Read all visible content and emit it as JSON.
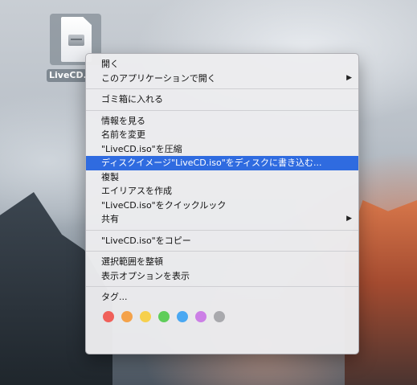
{
  "desktop": {
    "file_label": "LiveCD.iso"
  },
  "context_menu": {
    "group1": [
      {
        "label": "開く",
        "submenu": false
      },
      {
        "label": "このアプリケーションで開く",
        "submenu": true
      }
    ],
    "group2": [
      {
        "label": "ゴミ箱に入れる",
        "submenu": false
      }
    ],
    "group3": [
      {
        "label": "情報を見る",
        "submenu": false
      },
      {
        "label": "名前を変更",
        "submenu": false
      },
      {
        "label": "\"LiveCD.iso\"を圧縮",
        "submenu": false
      },
      {
        "label": "ディスクイメージ\"LiveCD.iso\"をディスクに書き込む...",
        "submenu": false,
        "highlighted": true
      },
      {
        "label": "複製",
        "submenu": false
      },
      {
        "label": "エイリアスを作成",
        "submenu": false
      },
      {
        "label": "\"LiveCD.iso\"をクイックルック",
        "submenu": false
      },
      {
        "label": "共有",
        "submenu": true
      }
    ],
    "group4": [
      {
        "label": "\"LiveCD.iso\"をコピー",
        "submenu": false
      }
    ],
    "group5": [
      {
        "label": "選択範囲を整頓",
        "submenu": false
      },
      {
        "label": "表示オプションを表示",
        "submenu": false
      }
    ],
    "group6": [
      {
        "label": "タグ...",
        "submenu": false
      }
    ],
    "submenu_arrow": "▶",
    "tag_colors": [
      {
        "name": "red",
        "color": "#f0605a"
      },
      {
        "name": "orange",
        "color": "#f4a24a"
      },
      {
        "name": "yellow",
        "color": "#f6d04d"
      },
      {
        "name": "green",
        "color": "#5fcd5a"
      },
      {
        "name": "blue",
        "color": "#4aa8f2"
      },
      {
        "name": "purple",
        "color": "#cc7fe6"
      },
      {
        "name": "gray",
        "color": "#a9a9ad"
      }
    ]
  }
}
